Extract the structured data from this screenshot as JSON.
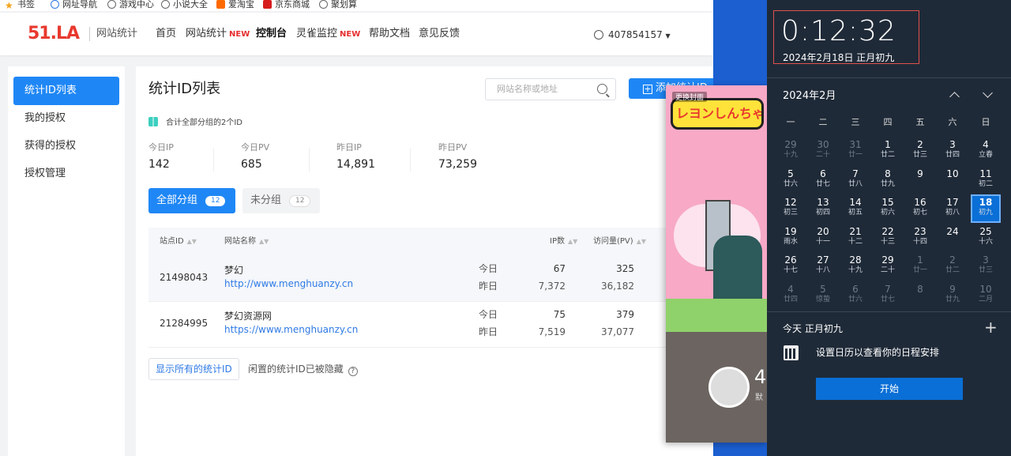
{
  "bookmarks": [
    {
      "label": "书签",
      "icon": "star-icon"
    },
    {
      "label": "网址导航",
      "icon": "navigation-icon"
    },
    {
      "label": "游戏中心",
      "icon": "globe-icon"
    },
    {
      "label": "小说大全",
      "icon": "globe-icon"
    },
    {
      "label": "爱淘宝",
      "icon": "taobao-icon"
    },
    {
      "label": "京东商城",
      "icon": "jd-icon"
    },
    {
      "label": "聚划算",
      "icon": "globe-icon"
    }
  ],
  "header": {
    "logo": "51.LA",
    "logo_sub": "网站统计",
    "nav": [
      {
        "label": "首页"
      },
      {
        "label": "网站统计",
        "badge": "NEW"
      },
      {
        "label": "控制台",
        "active": true
      },
      {
        "label": "灵雀监控",
        "badge": "NEW"
      },
      {
        "label": "帮助文档"
      },
      {
        "label": "意见反馈"
      }
    ],
    "user": "407854157"
  },
  "sidebar": {
    "items": [
      {
        "label": "统计ID列表",
        "active": true
      },
      {
        "label": "我的授权"
      },
      {
        "label": "获得的授权"
      },
      {
        "label": "授权管理"
      }
    ]
  },
  "main": {
    "title": "统计ID列表",
    "search_placeholder": "网站名称或地址",
    "add_button": "添加统计ID",
    "summary": "合计全部分组的2个ID",
    "stats": [
      {
        "label": "今日IP",
        "value": "142"
      },
      {
        "label": "今日PV",
        "value": "685"
      },
      {
        "label": "昨日IP",
        "value": "14,891"
      },
      {
        "label": "昨日PV",
        "value": "73,259"
      }
    ],
    "tabs": [
      {
        "label": "全部分组",
        "count": "12",
        "active": true
      },
      {
        "label": "未分组",
        "count": "12"
      }
    ],
    "columns": [
      "站点ID",
      "网站名称",
      "IP数",
      "访问量(PV)"
    ],
    "rows": [
      {
        "id": "21498043",
        "name": "梦幻",
        "url": "http://www.menghuanzy.cn",
        "today_label": "今日",
        "yesterday_label": "昨日",
        "ip_today": "67",
        "ip_yesterday": "7,372",
        "pv_today": "325",
        "pv_yesterday": "36,182"
      },
      {
        "id": "21284995",
        "name": "梦幻资源网",
        "url": "https://www.menghuanzy.cn",
        "today_label": "今日",
        "yesterday_label": "昨日",
        "ip_today": "75",
        "ip_yesterday": "7,519",
        "pv_today": "379",
        "pv_yesterday": "37,077"
      }
    ],
    "show_all": "显示所有的统计ID",
    "hidden_note": "闲置的统计ID已被隐藏"
  },
  "popup": {
    "art_title": "レヨンしんちゃ",
    "badge": "更换封面",
    "avatar_number": "4",
    "avatar_sub": "默"
  },
  "calendar": {
    "time": "0:12:32",
    "date": "2024年2月18日 正月初九",
    "month_label": "2024年2月",
    "weekdays": [
      "一",
      "二",
      "三",
      "四",
      "五",
      "六",
      "日"
    ],
    "days": [
      {
        "d": "29",
        "l": "十九",
        "other": true
      },
      {
        "d": "30",
        "l": "二十",
        "other": true
      },
      {
        "d": "31",
        "l": "廿一",
        "other": true
      },
      {
        "d": "1",
        "l": "廿二"
      },
      {
        "d": "2",
        "l": "廿三"
      },
      {
        "d": "3",
        "l": "廿四"
      },
      {
        "d": "4",
        "l": "立春"
      },
      {
        "d": "5",
        "l": "廿六"
      },
      {
        "d": "6",
        "l": "廿七"
      },
      {
        "d": "7",
        "l": "廿八"
      },
      {
        "d": "8",
        "l": "廿九"
      },
      {
        "d": "9",
        "l": ""
      },
      {
        "d": "10",
        "l": ""
      },
      {
        "d": "11",
        "l": "初二"
      },
      {
        "d": "12",
        "l": "初三"
      },
      {
        "d": "13",
        "l": "初四"
      },
      {
        "d": "14",
        "l": "初五"
      },
      {
        "d": "15",
        "l": "初六"
      },
      {
        "d": "16",
        "l": "初七"
      },
      {
        "d": "17",
        "l": "初八"
      },
      {
        "d": "18",
        "l": "初九",
        "today": true
      },
      {
        "d": "19",
        "l": "雨水"
      },
      {
        "d": "20",
        "l": "十一"
      },
      {
        "d": "21",
        "l": "十二"
      },
      {
        "d": "22",
        "l": "十三"
      },
      {
        "d": "23",
        "l": "十四"
      },
      {
        "d": "24",
        "l": ""
      },
      {
        "d": "25",
        "l": "十六"
      },
      {
        "d": "26",
        "l": "十七"
      },
      {
        "d": "27",
        "l": "十八"
      },
      {
        "d": "28",
        "l": "十九"
      },
      {
        "d": "29",
        "l": "二十"
      },
      {
        "d": "1",
        "l": "廿一",
        "other": true
      },
      {
        "d": "2",
        "l": "廿二",
        "other": true
      },
      {
        "d": "3",
        "l": "廿三",
        "other": true
      },
      {
        "d": "4",
        "l": "廿四",
        "other": true
      },
      {
        "d": "5",
        "l": "惊蛰",
        "other": true
      },
      {
        "d": "6",
        "l": "廿六",
        "other": true
      },
      {
        "d": "7",
        "l": "廿七",
        "other": true
      },
      {
        "d": "8",
        "l": "",
        "other": true
      },
      {
        "d": "9",
        "l": "廿九",
        "other": true
      },
      {
        "d": "10",
        "l": "二月",
        "other": true
      }
    ],
    "today_line": "今天 正月初九",
    "event_hint": "设置日历以查看你的日程安排",
    "start_button": "开始"
  },
  "colors": {
    "accent": "#1f87f5",
    "calendar_bg": "#1f2a38",
    "new_badge": "#e62e2e"
  }
}
